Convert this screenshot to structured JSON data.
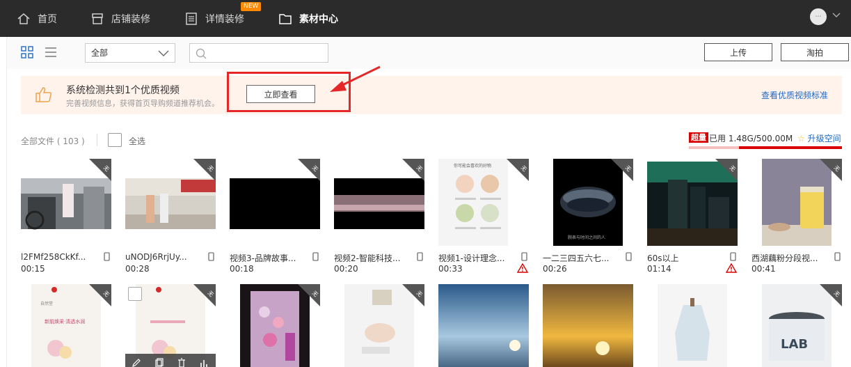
{
  "nav": {
    "home": "首页",
    "store_decor": "店铺装修",
    "detail_decor": "详情装修",
    "new_badge": "NEW",
    "materials": "素材中心"
  },
  "toolbar": {
    "filter_value": "全部",
    "search_placeholder": "",
    "upload": "上传",
    "taopai": "淘拍"
  },
  "banner": {
    "title": "系统检测共到1个优质视频",
    "subtitle": "完善视频信息，获得首页导购频道推荐机会。",
    "view_now": "立即查看",
    "link": "查看优质视频标准"
  },
  "files": {
    "count_label": "全部文件 ( 103 )",
    "select_all": "全选",
    "over_badge": "超量",
    "usage": "已用 1.48G/500.00M",
    "upgrade": "升级空间",
    "used_fraction": 2.96
  },
  "videos": [
    {
      "name": "l2FMf258CkKf...",
      "duration": "00:15",
      "warn": false
    },
    {
      "name": "uNODJ6RrjUy...",
      "duration": "00:28",
      "warn": false
    },
    {
      "name": "视频3-品牌故事...",
      "duration": "00:18",
      "warn": false
    },
    {
      "name": "视频2-智能科技...",
      "duration": "00:20",
      "warn": false
    },
    {
      "name": "视频1-设计理念...",
      "duration": "00:33",
      "warn": true
    },
    {
      "name": "一二三四五六七...",
      "duration": "00:26",
      "warn": false
    },
    {
      "name": "60s以上",
      "duration": "01:14",
      "warn": true
    },
    {
      "name": "西湖藕粉分段视...",
      "duration": "00:41",
      "warn": false
    }
  ],
  "thumb_text": {
    "recipe_title": "你可能会喜欢的好物",
    "watch_caption": "腕表与时间之间的人",
    "cosmetic_line": "新肌焕采·清透水润",
    "cosmetic_brand": "自然堂",
    "lab_logo": "LAB"
  },
  "colors": {
    "nav_bg": "#2b2b2b",
    "banner_bg": "#fff3ec",
    "link": "#2169c4",
    "alert_red": "#e52727"
  }
}
